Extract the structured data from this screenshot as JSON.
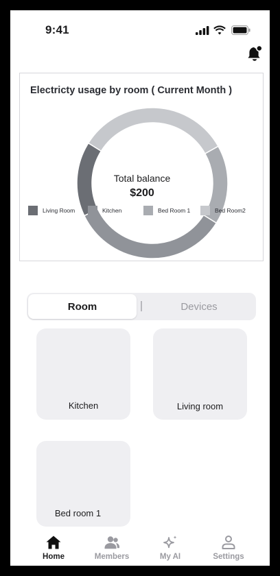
{
  "status_bar": {
    "time": "9:41"
  },
  "chart": {
    "title": "Electricty usage by room ( Current Month )",
    "center_label": "Total balance",
    "center_value": "$200",
    "colors": {
      "living_room": "#6b6e74",
      "kitchen": "#909399",
      "bed_room_1": "#a9acb1",
      "bed_room_2": "#c6c8cc"
    }
  },
  "chart_data": {
    "type": "pie",
    "categories": [
      "Living Room",
      "Kitchen",
      "Bed Room 1",
      "Bed Room2"
    ],
    "values": [
      16,
      34,
      17,
      33
    ],
    "title": "Electricty usage by room ( Current Month )",
    "legend_placement": "bottom"
  },
  "tabs": {
    "room_label": "Room",
    "devices_label": "Devices",
    "active": "Room"
  },
  "rooms": [
    {
      "name": "Kitchen"
    },
    {
      "name": "Living room"
    },
    {
      "name": "Bed room 1"
    }
  ],
  "tab_bar": {
    "items": [
      {
        "label": "Home",
        "icon": "home-icon",
        "active": true
      },
      {
        "label": "Members",
        "icon": "members-icon",
        "active": false
      },
      {
        "label": "My AI",
        "icon": "sparkle-icon",
        "active": false
      },
      {
        "label": "Settings",
        "icon": "person-icon",
        "active": false
      }
    ]
  }
}
